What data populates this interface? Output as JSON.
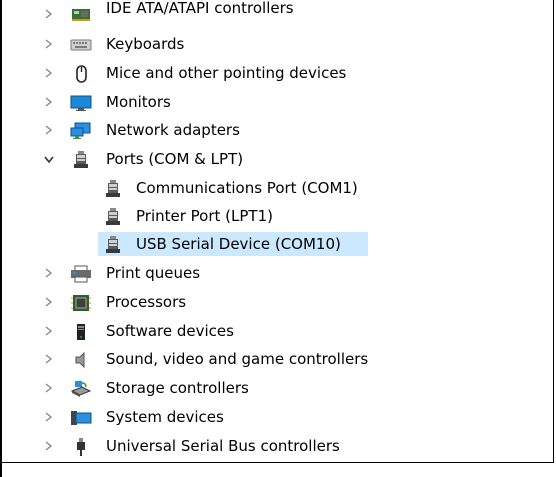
{
  "tree": {
    "items": [
      {
        "label": "IDE ATA/ATAPI controllers",
        "icon": "ide-controller-icon",
        "expanded": false
      },
      {
        "label": "Keyboards",
        "icon": "keyboard-icon",
        "expanded": false
      },
      {
        "label": "Mice and other pointing devices",
        "icon": "mouse-icon",
        "expanded": false
      },
      {
        "label": "Monitors",
        "icon": "monitor-icon",
        "expanded": false
      },
      {
        "label": "Network adapters",
        "icon": "network-adapter-icon",
        "expanded": false
      },
      {
        "label": "Ports (COM & LPT)",
        "icon": "port-icon",
        "expanded": true,
        "children": [
          {
            "label": "Communications Port (COM1)",
            "icon": "port-icon"
          },
          {
            "label": "Printer Port (LPT1)",
            "icon": "port-icon"
          },
          {
            "label": "USB Serial Device (COM10)",
            "icon": "port-icon",
            "selected": true
          }
        ]
      },
      {
        "label": "Print queues",
        "icon": "printer-icon",
        "expanded": false
      },
      {
        "label": "Processors",
        "icon": "processor-icon",
        "expanded": false
      },
      {
        "label": "Software devices",
        "icon": "software-device-icon",
        "expanded": false
      },
      {
        "label": "Sound, video and game controllers",
        "icon": "speaker-icon",
        "expanded": false
      },
      {
        "label": "Storage controllers",
        "icon": "storage-controller-icon",
        "expanded": false
      },
      {
        "label": "System devices",
        "icon": "system-devices-icon",
        "expanded": false
      },
      {
        "label": "Universal Serial Bus controllers",
        "icon": "usb-icon",
        "expanded": false
      }
    ]
  },
  "colors": {
    "selection": "#cce8ff",
    "chevron": "#8a8a8a"
  }
}
